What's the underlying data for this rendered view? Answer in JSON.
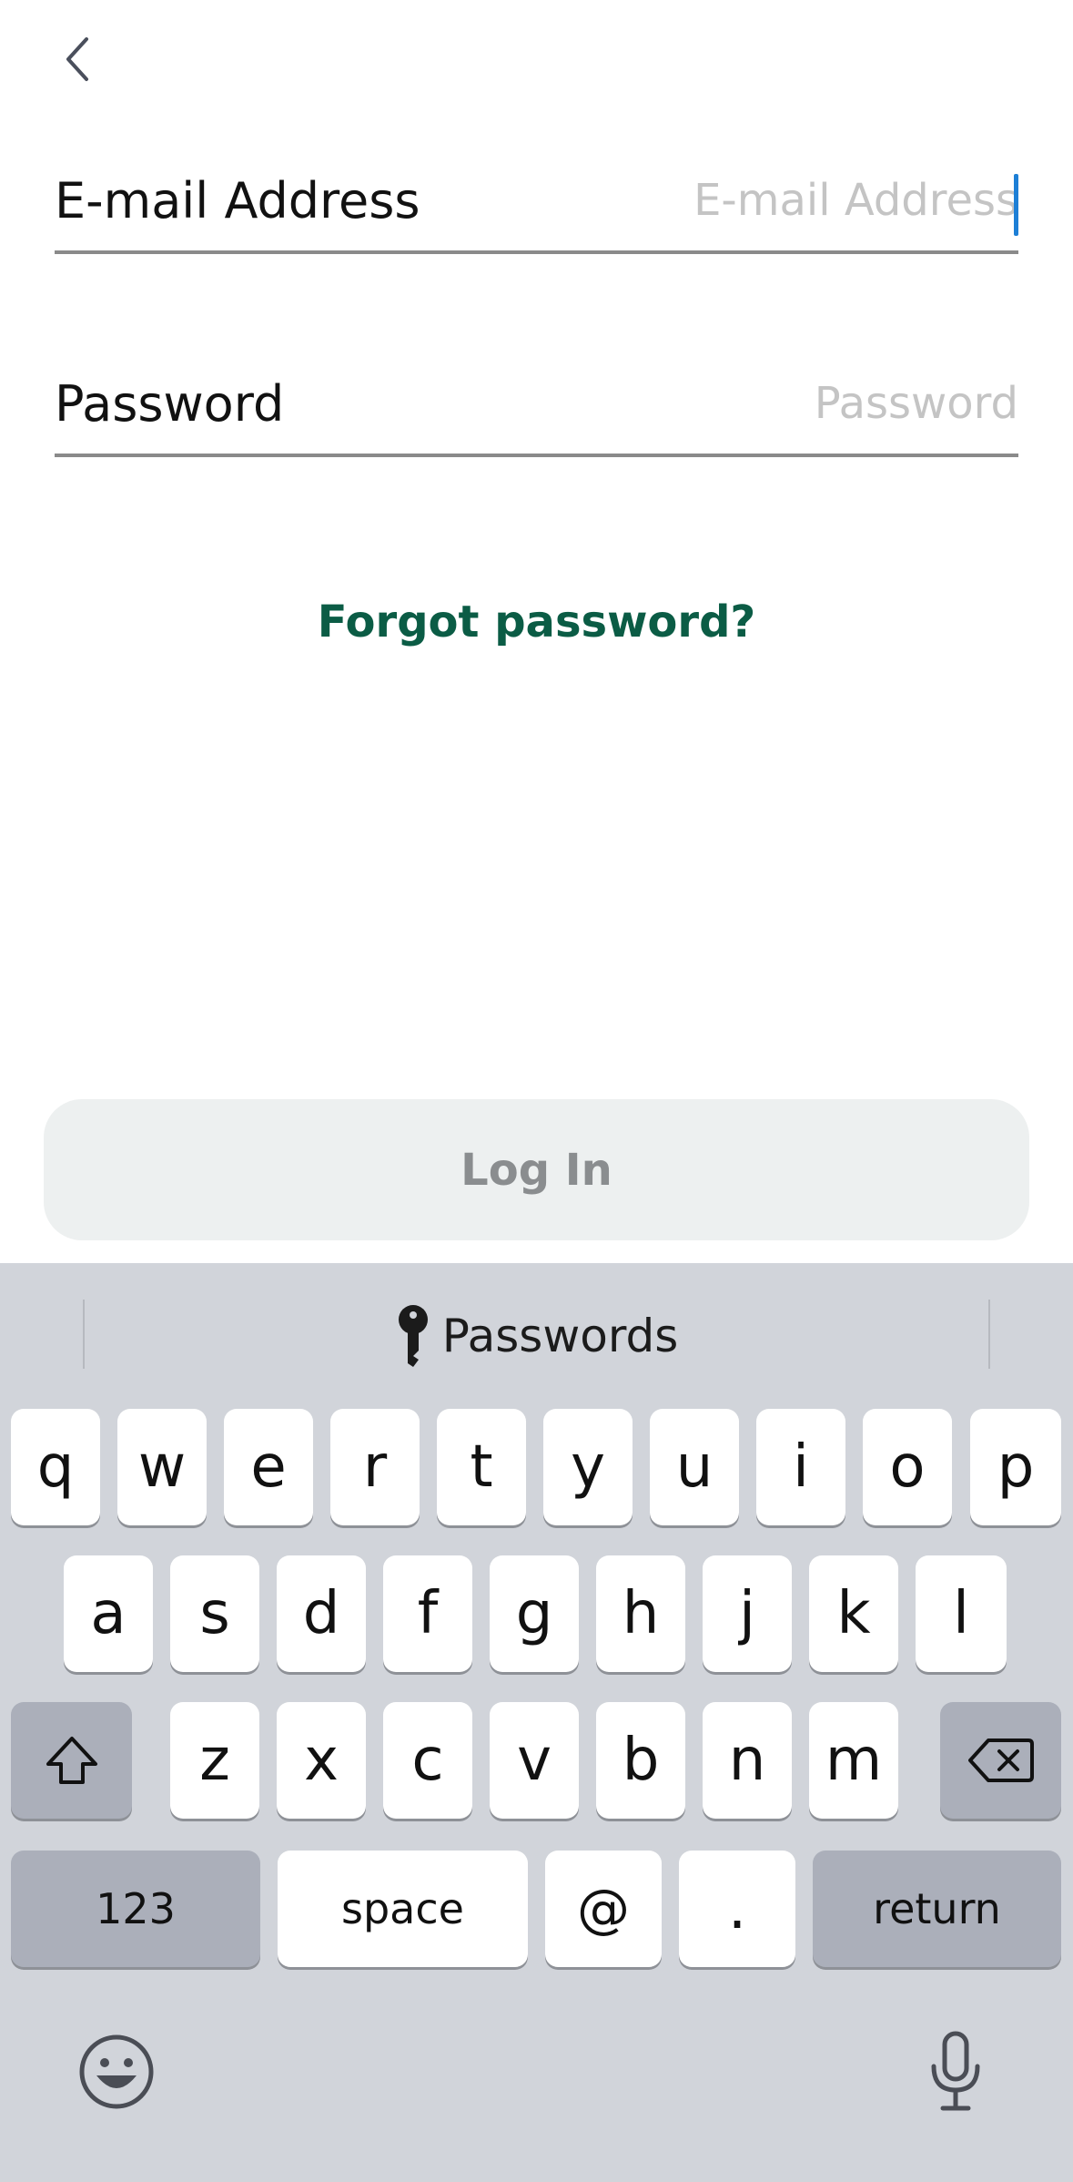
{
  "form": {
    "email_label": "E-mail Address",
    "email_placeholder": "E-mail Address",
    "email_value": "",
    "password_label": "Password",
    "password_placeholder": "Password",
    "password_value": "",
    "forgot_label": "Forgot password?",
    "login_label": "Log In"
  },
  "icons": {
    "back": "chevron-left-icon",
    "key": "key-icon",
    "shift": "shift-icon",
    "delete": "backspace-icon",
    "emoji": "emoji-icon",
    "mic": "microphone-icon"
  },
  "keyboard": {
    "suggestion": "Passwords",
    "row1": [
      "q",
      "w",
      "e",
      "r",
      "t",
      "y",
      "u",
      "i",
      "o",
      "p"
    ],
    "row2": [
      "a",
      "s",
      "d",
      "f",
      "g",
      "h",
      "j",
      "k",
      "l"
    ],
    "row3": [
      "z",
      "x",
      "c",
      "v",
      "b",
      "n",
      "m"
    ],
    "numbers_label": "123",
    "space_label": "space",
    "at_label": "@",
    "dot_label": ".",
    "return_label": "return"
  },
  "colors": {
    "accent_green": "#0b5c45",
    "caret_blue": "#1d7fd6",
    "keyboard_bg": "#d1d4da"
  }
}
